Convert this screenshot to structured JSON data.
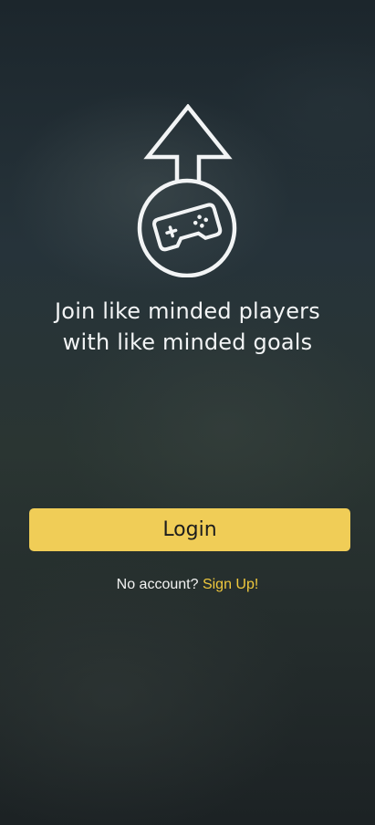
{
  "welcome": {
    "tagline_line1": "Join like minded players",
    "tagline_line2": "with like minded goals",
    "login_label": "Login",
    "no_account_text": "No account?",
    "signup_label": "Sign Up!"
  },
  "icons": {
    "logo": "arrow-up-gamepad-icon"
  },
  "colors": {
    "accent": "#f0cd57",
    "link": "#f0c93d",
    "text": "#f2f4f5",
    "background": "#232e33"
  }
}
